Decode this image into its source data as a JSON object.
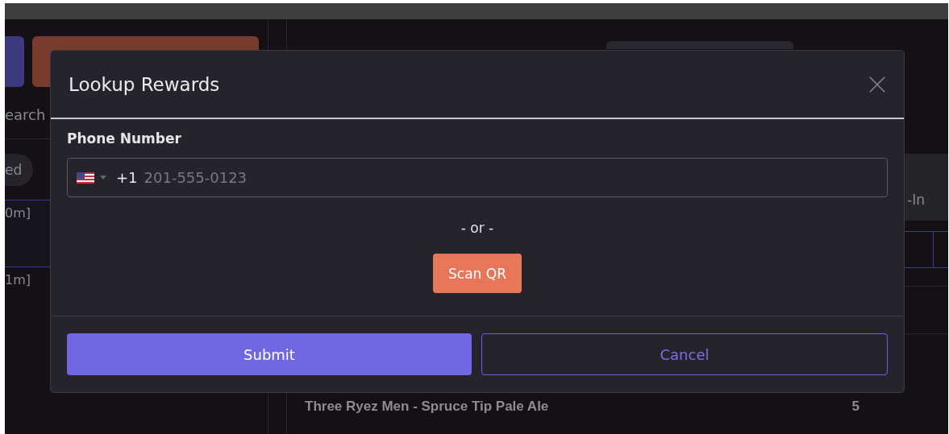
{
  "background": {
    "search_label": "earch",
    "filter_pill": "ed",
    "rows": [
      {
        "text": "0m]",
        "selected": true
      },
      {
        "text": "1m]",
        "selected": false
      }
    ],
    "column_header": "-In",
    "item": {
      "name": "Three Ryez Men - Spruce Tip Pale Ale",
      "quantity": "5"
    }
  },
  "dialog": {
    "title": "Lookup Rewards",
    "field_label": "Phone Number",
    "phone": {
      "country_code": "+1",
      "placeholder": "201-555-0123"
    },
    "separator": "- or -",
    "scan_button": "Scan QR",
    "buttons": [
      {
        "label": "Submit",
        "kind": "primary"
      },
      {
        "label": "Cancel",
        "kind": "secondary"
      }
    ]
  }
}
